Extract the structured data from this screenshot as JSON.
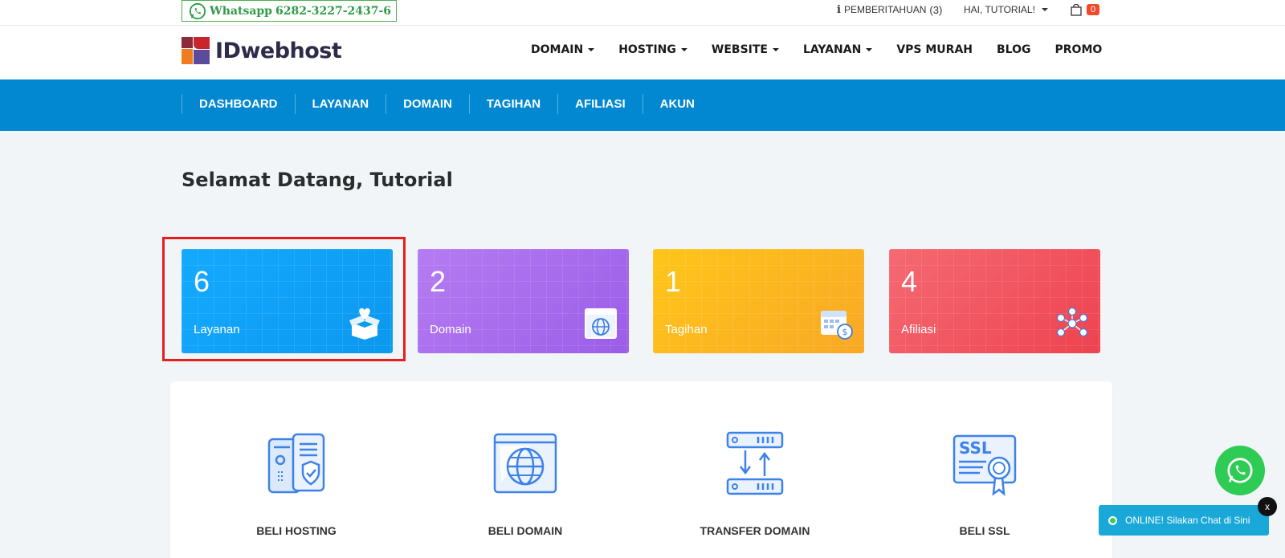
{
  "topbar": {
    "whatsapp_label": "Whatsapp",
    "whatsapp_number": "6282-3227-2437-6",
    "notifications_label": "PEMBERITAHUAN",
    "notifications_count": "(3)",
    "greeting": "HAI, TUTORIAL!",
    "cart_count": "0"
  },
  "header": {
    "logo_text": "IDwebhost",
    "nav": [
      {
        "label": "DOMAIN",
        "dropdown": true
      },
      {
        "label": "HOSTING",
        "dropdown": true
      },
      {
        "label": "WEBSITE",
        "dropdown": true
      },
      {
        "label": "LAYANAN",
        "dropdown": true
      },
      {
        "label": "VPS MURAH",
        "dropdown": false
      },
      {
        "label": "BLOG",
        "dropdown": false
      },
      {
        "label": "PROMO",
        "dropdown": false
      }
    ]
  },
  "client_nav": [
    "DASHBOARD",
    "LAYANAN",
    "DOMAIN",
    "TAGIHAN",
    "AFILIASI",
    "AKUN"
  ],
  "welcome": "Selamat Datang, Tutorial",
  "stats": [
    {
      "value": "6",
      "label": "Layanan",
      "icon": "box-heart-icon",
      "color": "#00a1f3"
    },
    {
      "value": "2",
      "label": "Domain",
      "icon": "browser-globe-icon",
      "color": "#a56bee"
    },
    {
      "value": "1",
      "label": "Tagihan",
      "icon": "calendar-dollar-icon",
      "color": "#fdb913"
    },
    {
      "value": "4",
      "label": "Afiliasi",
      "icon": "network-people-icon",
      "color": "#f2525d"
    }
  ],
  "actions": [
    {
      "label": "BELI HOSTING",
      "icon": "server-shield-icon"
    },
    {
      "label": "BELI DOMAIN",
      "icon": "browser-globe-icon"
    },
    {
      "label": "TRANSFER DOMAIN",
      "icon": "server-transfer-icon"
    },
    {
      "label": "BELI SSL",
      "icon": "ssl-certificate-icon"
    }
  ],
  "chat": {
    "status_text": "ONLINE! Silakan Chat di Sini",
    "close_label": "x"
  }
}
